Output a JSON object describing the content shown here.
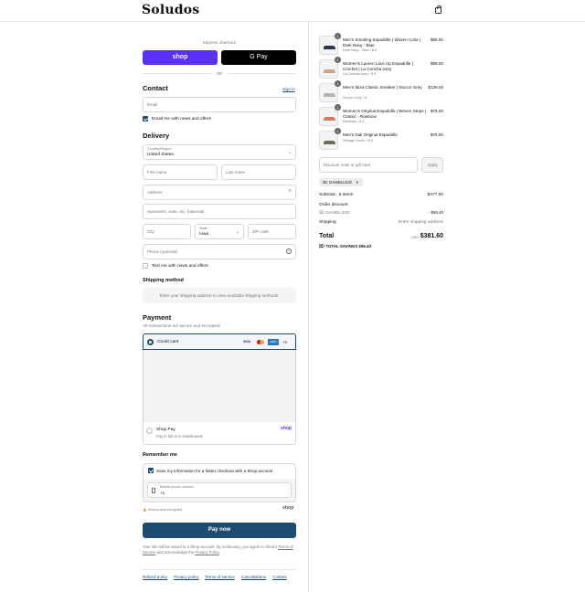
{
  "header": {
    "logo": "Soludos",
    "cart_icon": "shopping-bag-icon"
  },
  "express": {
    "label": "Express checkout",
    "shop_pay": "shop",
    "google_pay": "G Pay",
    "or": "OR"
  },
  "contact": {
    "title": "Contact",
    "sign_in": "Sign in",
    "email_placeholder": "Email",
    "email_news": "Email me with news and offers",
    "email_news_checked": true
  },
  "delivery": {
    "title": "Delivery",
    "country_label": "Country/Region",
    "country_value": "United States",
    "first_name": "First name",
    "last_name": "Last name",
    "address": "Address",
    "apartment": "Apartment, suite, etc. (optional)",
    "city": "City",
    "state_label": "State",
    "state_value": "Iowa",
    "zip": "ZIP code",
    "phone": "Phone (optional)",
    "text_news": "Text me with news and offers",
    "text_news_checked": false
  },
  "shipping": {
    "title": "Shipping method",
    "message": "Enter your shipping address to view available shipping methods."
  },
  "payment": {
    "title": "Payment",
    "subtitle": "All transactions are secure and encrypted.",
    "credit_card": "Credit card",
    "card_brands": [
      "VISA",
      "MC",
      "AMEX"
    ],
    "more_cards": "+3",
    "shop_pay_label": "Shop Pay",
    "shop_pay_sub": "Pay in full or in installments",
    "shop_pay_logo": "shop"
  },
  "remember": {
    "title": "Remember me",
    "save_label": "Save my information for a faster checkout with a Shop account",
    "save_checked": true,
    "phone_label": "Mobile phone number",
    "phone_prefix": "+1",
    "secure": "Secure and encrypted",
    "shop_logo": "shop"
  },
  "pay_button": "Pay now",
  "legal": {
    "text_before": "Your info will be saved to a Shop account. By continuing, you agree to Shop’s",
    "terms": "Terms of Service",
    "text_mid": "and acknowledge the",
    "privacy": "Privacy Policy",
    "text_end": "."
  },
  "footer_links": [
    "Refund policy",
    "Privacy policy",
    "Terms of service",
    "Cancellations",
    "Contact"
  ],
  "order": {
    "items": [
      {
        "qty": "1",
        "name": "Men's Smoking Espadrille | Woven Color | Dark Navy - Blue",
        "variant": "Dark Navy - Blue / 8.5",
        "price": "$85.00",
        "color": "#2b3550"
      },
      {
        "qty": "1",
        "name": "Women's Lauren Lace Up Espadrille | Crochet | La Concha Ivory",
        "variant": "La Concha Ivory / 5.5",
        "price": "$99.00",
        "color": "#c9a58a"
      },
      {
        "qty": "1",
        "name": "Men's Ibiza Classic Sneaker | Stucco Grey",
        "variant": "Stucco Grey / 8",
        "price": "$139.00",
        "color": "#b8b2a8"
      },
      {
        "qty": "1",
        "name": "Women's Original Espadrille | Woven Stripe | Classic - Rainbow",
        "variant": "Rainbow / 5.5",
        "price": "$79.00",
        "color": "#d77a5f"
      },
      {
        "qty": "1",
        "name": "Men's Dali Original Espadrille",
        "variant": "Vintage Green / 8.5",
        "price": "$75.00",
        "color": "#6b6f55"
      }
    ],
    "discount_placeholder": "Discount code or gift card",
    "apply": "Apply",
    "applied_code": "DANIELLE20",
    "subtotal_label": "Subtotal · 5 items",
    "subtotal": "$477.00",
    "order_discount_label": "Order discount",
    "discount_code": "DANIELLE20",
    "discount_amount": "- $95.40",
    "shipping_label": "Shipping",
    "shipping_value": "Enter shipping address",
    "total_label": "Total",
    "currency": "USD",
    "total": "$381.60",
    "savings_label": "TOTAL SAVINGS",
    "savings": "$95.40"
  },
  "colors": {
    "accent": "#1f4b6e",
    "shop_purple": "#5a31f4",
    "border": "#d9d9d9"
  }
}
